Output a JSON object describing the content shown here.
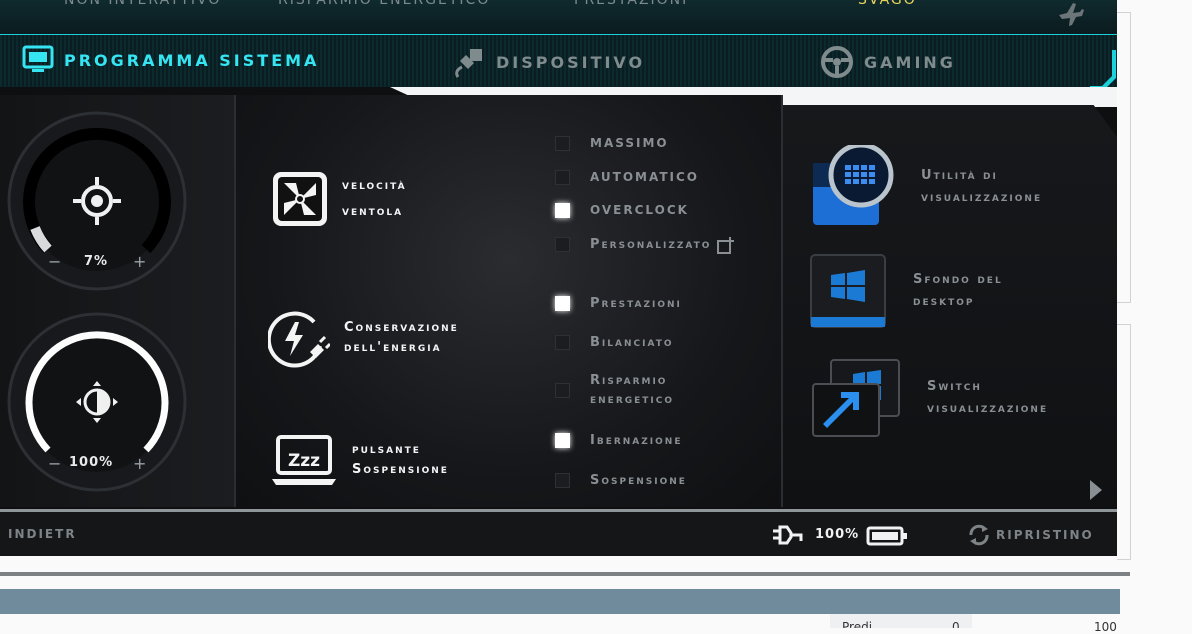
{
  "top_menu": {
    "items": [
      "Non interattivo",
      "Risparmio energetico",
      "Prestazioni",
      "Svago"
    ],
    "active_index": 3
  },
  "tabs": [
    {
      "label": "PROGRAMMA SISTEMA",
      "icon": "monitor-icon",
      "active": true
    },
    {
      "label": "DISPOSITIVO",
      "icon": "plug-icon",
      "active": false
    },
    {
      "label": "GAMING",
      "icon": "steering-wheel-icon",
      "active": false
    }
  ],
  "dials": {
    "fan": {
      "value_label": "7%",
      "value": 7,
      "minus": "−",
      "plus": "+",
      "icon": "fan-target-icon"
    },
    "brightness": {
      "value_label": "100%",
      "value": 100,
      "minus": "−",
      "plus": "+",
      "icon": "brightness-icon"
    }
  },
  "features": {
    "fan_speed": {
      "line1": "velocità",
      "line2": "ventola",
      "icon": "fan-icon"
    },
    "energy": {
      "line1": "Conservazione",
      "line2": "dell'energia",
      "icon": "energy-plug-icon"
    },
    "sleep_button": {
      "line1": "pulsante",
      "line2": "Sospensione",
      "icon": "sleep-laptop-icon"
    }
  },
  "fan_options": [
    {
      "label": "MASSIMO",
      "checked": false
    },
    {
      "label": "AUTOMATICO",
      "checked": false
    },
    {
      "label": "OVERCLOCK",
      "checked": true
    },
    {
      "label": "Personalizzato",
      "checked": false
    }
  ],
  "energy_options": [
    {
      "label": "Prestazioni",
      "checked": true
    },
    {
      "label": "Bilanciato",
      "checked": false
    },
    {
      "label": "Risparmio",
      "label2": "energetico",
      "checked": false
    }
  ],
  "sleep_options": [
    {
      "label": "Ibernazione",
      "checked": true
    },
    {
      "label": "Sospensione",
      "checked": false
    }
  ],
  "utilities": [
    {
      "line1": "Utilità di",
      "line2": "visualizzazione",
      "icon": "display-utility-icon"
    },
    {
      "line1": "Sfondo del",
      "line2": "desktop",
      "icon": "windows-wallpaper-icon"
    },
    {
      "line1": "Switch",
      "line2": "visualizzazione",
      "icon": "display-switch-icon"
    }
  ],
  "bottom": {
    "back_label": "INDIETR",
    "battery_pct": "100%",
    "reset_label": "RIPRISTINO"
  },
  "page": {
    "cell_text": "Predi",
    "cell_num": "0",
    "far_num": "100"
  },
  "colors": {
    "accent": "#1bd1db",
    "active_top": "#e7d35a",
    "checked": "#ffffff"
  }
}
